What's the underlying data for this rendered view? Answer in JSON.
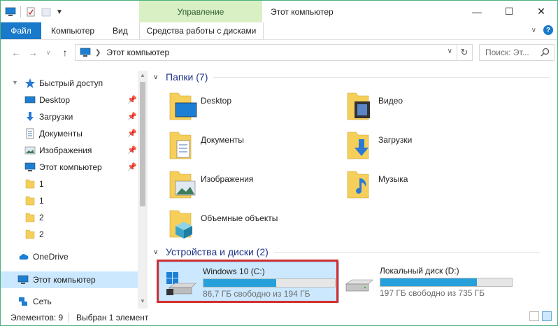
{
  "window": {
    "title": "Этот компьютер",
    "contextual_tab": "Управление",
    "minimize": "—",
    "maximize": "☐",
    "close": "✕"
  },
  "ribbon": {
    "file_tab": "Файл",
    "tabs": [
      "Компьютер",
      "Вид"
    ],
    "tools_tab": "Средства работы с дисками"
  },
  "address": {
    "path": "Этот компьютер",
    "search_placeholder": "Поиск: Эт..."
  },
  "nav": {
    "quick_access": "Быстрый доступ",
    "items": [
      {
        "label": "Desktop",
        "pinned": true
      },
      {
        "label": "Загрузки",
        "pinned": true
      },
      {
        "label": "Документы",
        "pinned": true
      },
      {
        "label": "Изображения",
        "pinned": true
      },
      {
        "label": "Этот компьютер",
        "pinned": true
      },
      {
        "label": "1"
      },
      {
        "label": "1"
      },
      {
        "label": "2"
      },
      {
        "label": "2"
      }
    ],
    "onedrive": "OneDrive",
    "this_pc": "Этот компьютер",
    "network": "Сеть"
  },
  "folders_group": {
    "title": "Папки (7)",
    "items": [
      "Desktop",
      "Видео",
      "Документы",
      "Загрузки",
      "Изображения",
      "Музыка",
      "Объемные объекты"
    ]
  },
  "devices_group": {
    "title": "Устройства и диски (2)",
    "drives": [
      {
        "name": "Windows 10 (C:)",
        "free_text": "86,7 ГБ свободно из 194 ГБ",
        "used_fraction": 0.553
      },
      {
        "name": "Локальный диск (D:)",
        "free_text": "197 ГБ свободно из 735 ГБ",
        "used_fraction": 0.732
      }
    ]
  },
  "status": {
    "items_count": "Элементов: 9",
    "selected": "Выбран 1 элемент"
  },
  "colors": {
    "accent": "#1979ca",
    "selection": "#cce8ff",
    "progress": "#26a0da",
    "highlight_frame": "#d32f2f"
  }
}
